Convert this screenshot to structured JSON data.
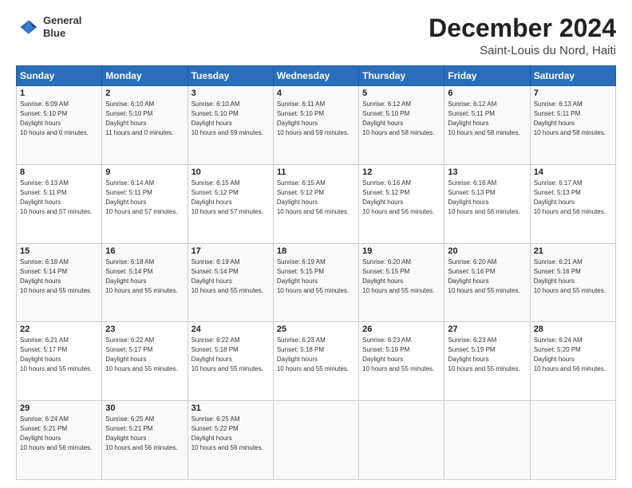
{
  "header": {
    "logo_line1": "General",
    "logo_line2": "Blue",
    "month": "December 2024",
    "location": "Saint-Louis du Nord, Haiti"
  },
  "weekdays": [
    "Sunday",
    "Monday",
    "Tuesday",
    "Wednesday",
    "Thursday",
    "Friday",
    "Saturday"
  ],
  "weeks": [
    [
      {
        "day": "1",
        "sunrise": "6:09 AM",
        "sunset": "5:10 PM",
        "daylight": "10 hours and 0 minutes."
      },
      {
        "day": "2",
        "sunrise": "6:10 AM",
        "sunset": "5:10 PM",
        "daylight": "11 hours and 0 minutes."
      },
      {
        "day": "3",
        "sunrise": "6:10 AM",
        "sunset": "5:10 PM",
        "daylight": "10 hours and 59 minutes."
      },
      {
        "day": "4",
        "sunrise": "6:11 AM",
        "sunset": "5:10 PM",
        "daylight": "10 hours and 59 minutes."
      },
      {
        "day": "5",
        "sunrise": "6:12 AM",
        "sunset": "5:10 PM",
        "daylight": "10 hours and 58 minutes."
      },
      {
        "day": "6",
        "sunrise": "6:12 AM",
        "sunset": "5:11 PM",
        "daylight": "10 hours and 58 minutes."
      },
      {
        "day": "7",
        "sunrise": "6:13 AM",
        "sunset": "5:11 PM",
        "daylight": "10 hours and 58 minutes."
      }
    ],
    [
      {
        "day": "8",
        "sunrise": "6:13 AM",
        "sunset": "5:11 PM",
        "daylight": "10 hours and 57 minutes."
      },
      {
        "day": "9",
        "sunrise": "6:14 AM",
        "sunset": "5:11 PM",
        "daylight": "10 hours and 57 minutes."
      },
      {
        "day": "10",
        "sunrise": "6:15 AM",
        "sunset": "5:12 PM",
        "daylight": "10 hours and 57 minutes."
      },
      {
        "day": "11",
        "sunrise": "6:15 AM",
        "sunset": "5:12 PM",
        "daylight": "10 hours and 56 minutes."
      },
      {
        "day": "12",
        "sunrise": "6:16 AM",
        "sunset": "5:12 PM",
        "daylight": "10 hours and 56 minutes."
      },
      {
        "day": "13",
        "sunrise": "6:16 AM",
        "sunset": "5:13 PM",
        "daylight": "10 hours and 56 minutes."
      },
      {
        "day": "14",
        "sunrise": "6:17 AM",
        "sunset": "5:13 PM",
        "daylight": "10 hours and 56 minutes."
      }
    ],
    [
      {
        "day": "15",
        "sunrise": "6:18 AM",
        "sunset": "5:14 PM",
        "daylight": "10 hours and 55 minutes."
      },
      {
        "day": "16",
        "sunrise": "6:18 AM",
        "sunset": "5:14 PM",
        "daylight": "10 hours and 55 minutes."
      },
      {
        "day": "17",
        "sunrise": "6:19 AM",
        "sunset": "5:14 PM",
        "daylight": "10 hours and 55 minutes."
      },
      {
        "day": "18",
        "sunrise": "6:19 AM",
        "sunset": "5:15 PM",
        "daylight": "10 hours and 55 minutes."
      },
      {
        "day": "19",
        "sunrise": "6:20 AM",
        "sunset": "5:15 PM",
        "daylight": "10 hours and 55 minutes."
      },
      {
        "day": "20",
        "sunrise": "6:20 AM",
        "sunset": "5:16 PM",
        "daylight": "10 hours and 55 minutes."
      },
      {
        "day": "21",
        "sunrise": "6:21 AM",
        "sunset": "5:16 PM",
        "daylight": "10 hours and 55 minutes."
      }
    ],
    [
      {
        "day": "22",
        "sunrise": "6:21 AM",
        "sunset": "5:17 PM",
        "daylight": "10 hours and 55 minutes."
      },
      {
        "day": "23",
        "sunrise": "6:22 AM",
        "sunset": "5:17 PM",
        "daylight": "10 hours and 55 minutes."
      },
      {
        "day": "24",
        "sunrise": "6:22 AM",
        "sunset": "5:18 PM",
        "daylight": "10 hours and 55 minutes."
      },
      {
        "day": "25",
        "sunrise": "6:23 AM",
        "sunset": "5:18 PM",
        "daylight": "10 hours and 55 minutes."
      },
      {
        "day": "26",
        "sunrise": "6:23 AM",
        "sunset": "5:19 PM",
        "daylight": "10 hours and 55 minutes."
      },
      {
        "day": "27",
        "sunrise": "6:23 AM",
        "sunset": "5:19 PM",
        "daylight": "10 hours and 55 minutes."
      },
      {
        "day": "28",
        "sunrise": "6:24 AM",
        "sunset": "5:20 PM",
        "daylight": "10 hours and 56 minutes."
      }
    ],
    [
      {
        "day": "29",
        "sunrise": "6:24 AM",
        "sunset": "5:21 PM",
        "daylight": "10 hours and 56 minutes."
      },
      {
        "day": "30",
        "sunrise": "6:25 AM",
        "sunset": "5:21 PM",
        "daylight": "10 hours and 56 minutes."
      },
      {
        "day": "31",
        "sunrise": "6:25 AM",
        "sunset": "5:22 PM",
        "daylight": "10 hours and 56 minutes."
      },
      null,
      null,
      null,
      null
    ]
  ]
}
